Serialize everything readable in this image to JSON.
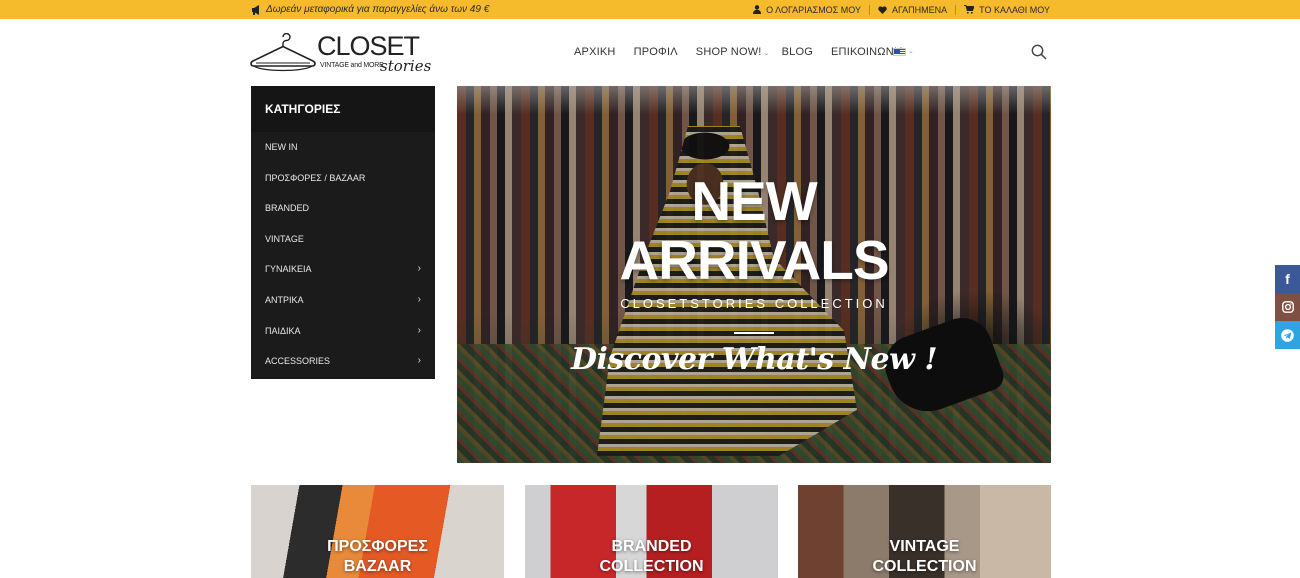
{
  "topbar": {
    "promo": "Δωρεάν μεταφορικά για παραγγελίες άνω των 49 €",
    "account": "Ο ΛΟΓΑΡΙΑΣΜΟΣ ΜΟΥ",
    "wishlist": "ΑΓΑΠΗΜΕΝΑ",
    "cart": "ΤΟ ΚΑΛΑΘΙ ΜΟΥ"
  },
  "logo": {
    "main": "CLOSET",
    "tagline": "VINTAGE and MORE",
    "script": "stories"
  },
  "nav": {
    "items": [
      "ΑΡΧΙΚΗ",
      "ΠΡΟΦΙΛ",
      "SHOP NOW!",
      "BLOG",
      "ΕΠΙΚΟΙΝΩΝΙΑ"
    ]
  },
  "categories": {
    "title": "ΚΑΤΗΓΟΡΙΕΣ",
    "items": [
      {
        "label": "NEW IN",
        "submenu": false
      },
      {
        "label": "ΠΡΟΣΦΟΡΕΣ / BAZAAR",
        "submenu": false
      },
      {
        "label": "BRANDED",
        "submenu": false
      },
      {
        "label": "VINTAGE",
        "submenu": false
      },
      {
        "label": "ΓΥΝΑΙΚΕΙΑ",
        "submenu": true
      },
      {
        "label": "ΑΝΤΡΙΚΑ",
        "submenu": true
      },
      {
        "label": "ΠΑΙΔΙΚΑ",
        "submenu": true
      },
      {
        "label": "ACCESSORIES",
        "submenu": true
      }
    ]
  },
  "hero": {
    "line1": "NEW",
    "line2": "ARRIVALS",
    "subtitle": "CLOSETSTORIES COLLECTION",
    "cta": "Discover What's New !"
  },
  "tiles": [
    {
      "line1": "ΠΡΟΣΦΟΡΕΣ",
      "line2": "BAZAAR"
    },
    {
      "line1": "BRANDED",
      "line2": "COLLECTION"
    },
    {
      "line1": "VINTAGE",
      "line2": "COLLECTION"
    }
  ],
  "social": {
    "facebook_icon": "f"
  },
  "icons": [
    "megaphone-icon",
    "user-icon",
    "heart-icon",
    "cart-icon",
    "search-icon",
    "greek-flag-icon",
    "chevron-right-icon",
    "facebook-icon",
    "instagram-icon",
    "telegram-icon"
  ],
  "colors": {
    "accent": "#f6bb2c",
    "sidebar": "#1b1b1b",
    "facebook": "#3b5998",
    "instagram": "#7e4f42",
    "telegram": "#2ca5e0"
  }
}
